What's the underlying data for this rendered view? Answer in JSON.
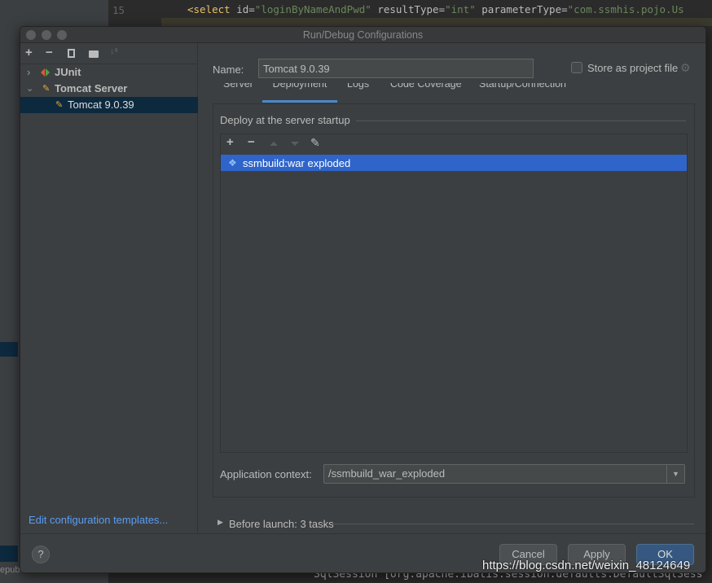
{
  "editor": {
    "line_number": "15",
    "code_prefix": "<select ",
    "code_attr1": "id=",
    "code_val1": "\"loginByNameAndPwd\"",
    "code_attr2": " resultType=",
    "code_val2": "\"int\"",
    "code_attr3": " parameterType=",
    "code_val3": "\"com.ssmhis.pojo.Us",
    "bottom_code": "SqlSession [org.apache.ibatis.session.defaults.DefaultSqlSess",
    "left_text": "epublic"
  },
  "dialog": {
    "title": "Run/Debug Configurations"
  },
  "sidebar": {
    "toolbar": [
      "+",
      "−",
      "copy",
      "folder",
      "sort"
    ],
    "items": [
      {
        "label": "JUnit",
        "expanded": false
      },
      {
        "label": "Tomcat Server",
        "expanded": true
      },
      {
        "label": "Tomcat 9.0.39",
        "selected": true
      }
    ],
    "edit_templates_link": "Edit configuration templates..."
  },
  "form": {
    "name_label": "Name:",
    "name_value": "Tomcat 9.0.39",
    "store_label": "Store as project file",
    "store_checked": false
  },
  "tabs": [
    {
      "label": "Server"
    },
    {
      "label": "Deployment",
      "active": true
    },
    {
      "label": "Logs"
    },
    {
      "label": "Code Coverage"
    },
    {
      "label": "Startup/Connection"
    }
  ],
  "deployment": {
    "section_title": "Deploy at the server startup",
    "items": [
      {
        "label": "ssmbuild:war exploded",
        "selected": true
      }
    ],
    "app_context_label": "Application context:",
    "app_context_value": "/ssmbuild_war_exploded"
  },
  "before_launch": "Before launch: 3 tasks",
  "buttons": {
    "help": "?",
    "cancel": "Cancel",
    "apply": "Apply",
    "ok": "OK"
  },
  "watermark": "https://blog.csdn.net/weixin_48124649",
  "colors": {
    "accent": "#4a88c7",
    "selection": "#2f65ca",
    "link": "#589df6",
    "ok": "#365880"
  }
}
